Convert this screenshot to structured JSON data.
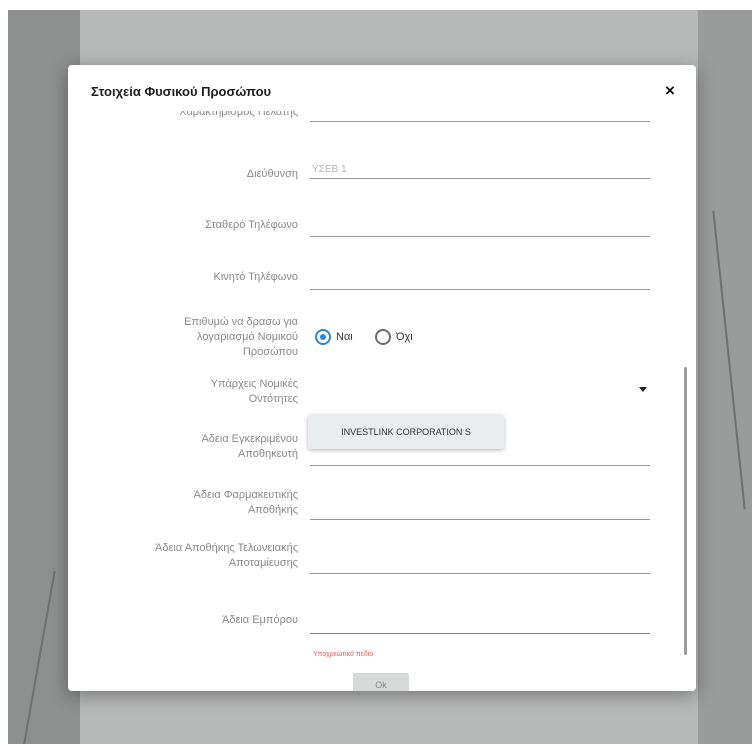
{
  "dialog": {
    "title": "Στοιχεία Φυσικού Προσώπου",
    "close_label": "×"
  },
  "form": {
    "partial_top_label": "Χαρακτηρισμός Πελάτης",
    "partial_top_value": "",
    "address_label": "Διεύθυνση",
    "address_value": "ΥΣΕΒ 1",
    "landline_label": "Σταθερό Τηλέφωνο",
    "landline_value": "",
    "mobile_label": "Κινητό Τηλέφωνο",
    "mobile_value": "",
    "act_for_company_label": "Επιθυμώ να δρασω για λογαριασμό Νομικού Προσώπου",
    "yes_label": "Ναι",
    "no_label": "Όχι",
    "selected_option": "Ναι",
    "entities_label": "Υπάρχεις Νομικές Οντότητες",
    "entities_chip": "INVESTLINK CORPORATION S",
    "warehouse_license_label": "Άδεια Εγκεκριμένου Αποθηκευτή",
    "pharma_license_label": "Άδεια Φαρμακευτικής Αποθήκης",
    "customs_license_label": "Άδεια Αποθήκης Τελωνειακής Αποταμίευσης",
    "trader_license_label": "Άδεια Εμπόρου",
    "required_error": "Υποχρεωτικό πεδίο",
    "ok_label": "Ok"
  },
  "colors": {
    "accent": "#2f89c9",
    "error": "#e35b5b"
  }
}
